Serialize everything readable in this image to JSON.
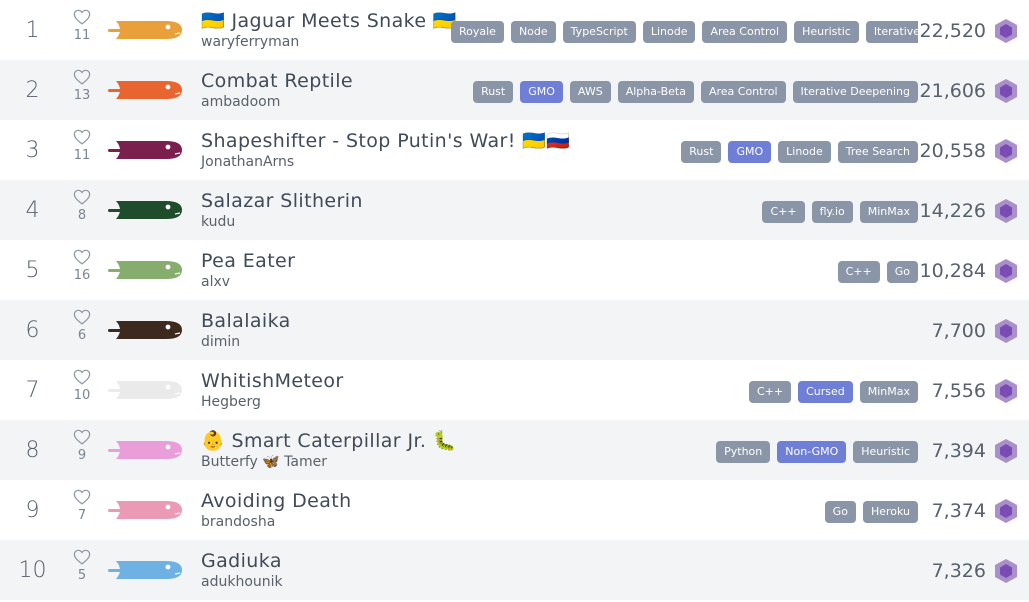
{
  "leaderboard": {
    "rows": [
      {
        "rank": "1",
        "likes": "11",
        "name": "🇺🇦 Jaguar Meets Snake 🇺🇦",
        "author": "waryferryman",
        "score": "22,520",
        "color": "#e9a03b",
        "tags": [
          "Royale",
          "Node",
          "TypeScript",
          "Linode",
          "Area Control",
          "Heuristic",
          "Iterative Deepening"
        ]
      },
      {
        "rank": "2",
        "likes": "13",
        "name": "Combat Reptile",
        "author": "ambadoom",
        "score": "21,606",
        "color": "#e8652f",
        "tags": [
          "Rust",
          "GMO",
          "AWS",
          "Alpha-Beta",
          "Area Control",
          "Iterative Deepening"
        ]
      },
      {
        "rank": "3",
        "likes": "11",
        "name": "Shapeshifter - Stop Putin's War! 🇺🇦🇷🇺",
        "author": "JonathanArns",
        "score": "20,558",
        "color": "#7b1f4e",
        "tags": [
          "Rust",
          "GMO",
          "Linode",
          "Tree Search"
        ]
      },
      {
        "rank": "4",
        "likes": "8",
        "name": "Salazar Slitherin",
        "author": "kudu",
        "score": "14,226",
        "color": "#1f4d2c",
        "tags": [
          "C++",
          "fly.io",
          "MinMax"
        ]
      },
      {
        "rank": "5",
        "likes": "16",
        "name": "Pea Eater",
        "author": "alxv",
        "score": "10,284",
        "color": "#86ad6e",
        "tags": [
          "C++",
          "Go"
        ]
      },
      {
        "rank": "6",
        "likes": "6",
        "name": "Balalaika",
        "author": "dimin",
        "score": "7,700",
        "color": "#3d2a1f",
        "tags": []
      },
      {
        "rank": "7",
        "likes": "10",
        "name": "WhitishMeteor",
        "author": "Hegberg",
        "score": "7,556",
        "color": "#eaeaea",
        "tags": [
          "C++",
          "Cursed",
          "MinMax"
        ]
      },
      {
        "rank": "8",
        "likes": "9",
        "name": "👶 Smart Caterpillar Jr. 🐛",
        "author": "Butterfy 🦋 Tamer",
        "score": "7,394",
        "color": "#e99dd9",
        "tags": [
          "Python",
          "Non-GMO",
          "Heuristic"
        ]
      },
      {
        "rank": "9",
        "likes": "7",
        "name": "Avoiding Death",
        "author": "brandosha",
        "score": "7,374",
        "color": "#ea9ab5",
        "tags": [
          "Go",
          "Heroku"
        ]
      },
      {
        "rank": "10",
        "likes": "5",
        "name": "Gadiuka",
        "author": "adukhounik",
        "score": "7,326",
        "color": "#6fb1e3",
        "tags": []
      }
    ],
    "highlight_tags": [
      "GMO",
      "Cursed",
      "Non-GMO"
    ],
    "colors": {
      "tag": "#8a95a8",
      "tag_highlight": "#6f7fd6",
      "gem_outer": "#a990c9",
      "gem_inner": "#7a4db5"
    },
    "icons": {
      "like": "heart-outline-icon",
      "snake": "snake-avatar-icon",
      "score": "gem-hexagon-icon"
    }
  }
}
